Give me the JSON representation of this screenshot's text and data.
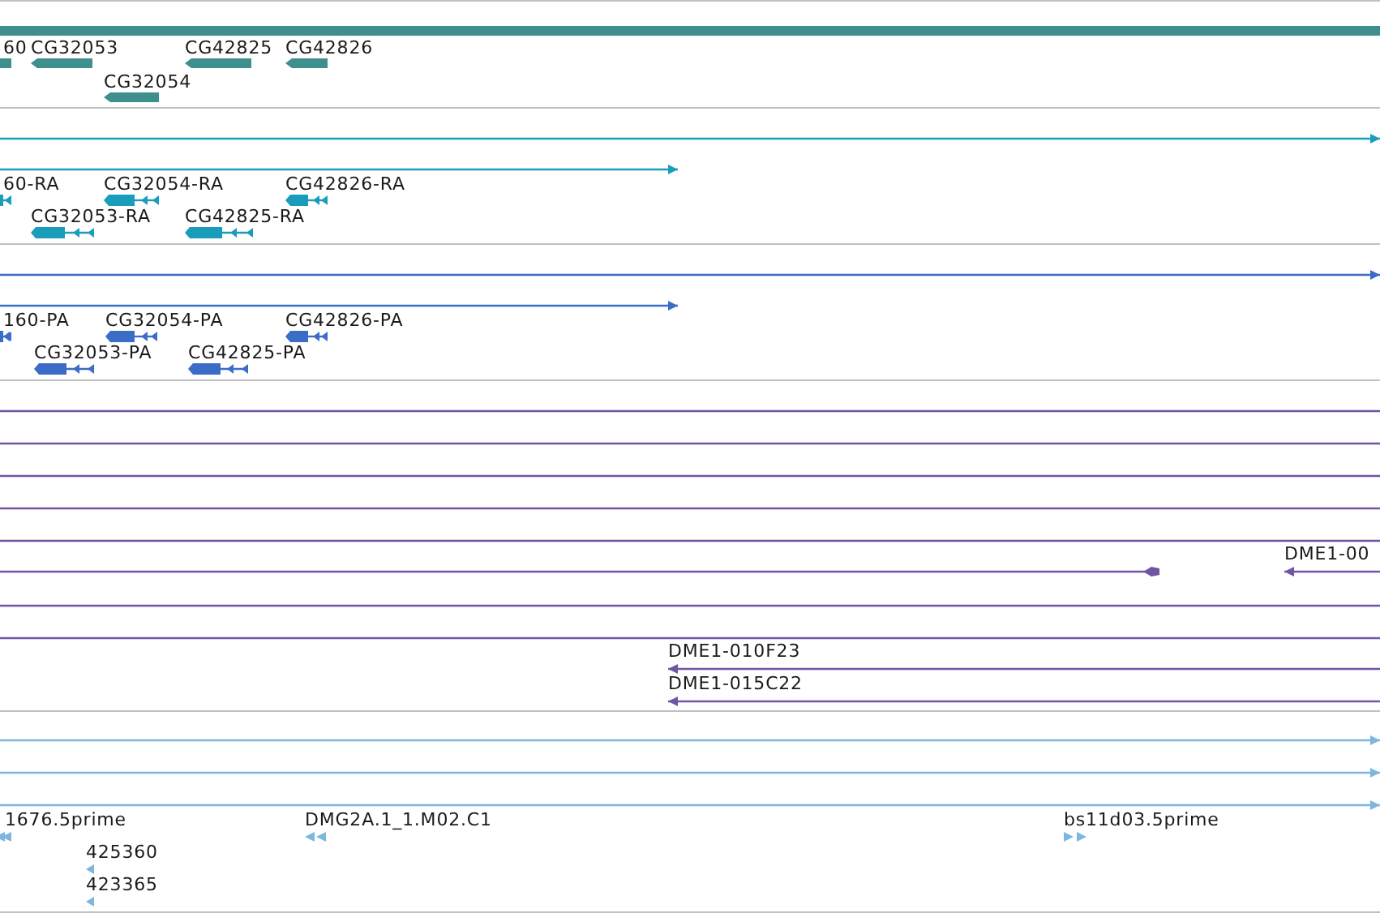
{
  "tracks": [
    {
      "color": "#3f8f8f",
      "features": [
        {
          "kind": "bar"
        },
        {
          "kind": "gene",
          "label": "60",
          "reverse": true
        },
        {
          "kind": "gene",
          "label": "CG32053",
          "reverse": true
        },
        {
          "kind": "gene",
          "label": "CG42825",
          "reverse": true
        },
        {
          "kind": "gene",
          "label": "CG42826",
          "reverse": true
        },
        {
          "kind": "gene",
          "label": "CG32054",
          "reverse": true
        }
      ]
    },
    {
      "color": "#1a9dba",
      "features": [
        {
          "kind": "line",
          "reverse": false
        },
        {
          "kind": "line",
          "reverse": false
        },
        {
          "kind": "transcript",
          "label": "60-RA",
          "reverse": true
        },
        {
          "kind": "transcript",
          "label": "CG32054-RA",
          "reverse": true
        },
        {
          "kind": "transcript",
          "label": "CG42826-RA",
          "reverse": true
        },
        {
          "kind": "transcript",
          "label": "CG32053-RA",
          "reverse": true
        },
        {
          "kind": "transcript",
          "label": "CG42825-RA",
          "reverse": true
        }
      ]
    },
    {
      "color": "#3a6cc8",
      "features": [
        {
          "kind": "line",
          "reverse": false
        },
        {
          "kind": "line",
          "reverse": false
        },
        {
          "kind": "transcript",
          "label": "160-PA",
          "reverse": true
        },
        {
          "kind": "transcript",
          "label": "CG32054-PA",
          "reverse": true
        },
        {
          "kind": "transcript",
          "label": "CG42826-PA",
          "reverse": true
        },
        {
          "kind": "transcript",
          "label": "CG32053-PA",
          "reverse": true
        },
        {
          "kind": "transcript",
          "label": "CG42825-PA",
          "reverse": true
        }
      ]
    },
    {
      "color": "#6f55a3",
      "features": [
        {
          "kind": "span"
        },
        {
          "kind": "span"
        },
        {
          "kind": "span"
        },
        {
          "kind": "span"
        },
        {
          "kind": "span"
        },
        {
          "kind": "line",
          "reverse": true
        },
        {
          "kind": "hit",
          "label": "DME1-00",
          "reverse": true
        },
        {
          "kind": "span"
        },
        {
          "kind": "span"
        },
        {
          "kind": "hit",
          "label": "DME1-010F23",
          "reverse": true
        },
        {
          "kind": "hit",
          "label": "DME1-015C22",
          "reverse": true
        }
      ]
    },
    {
      "color": "#7db6de",
      "features": [
        {
          "kind": "line",
          "reverse": false
        },
        {
          "kind": "line",
          "reverse": false
        },
        {
          "kind": "line",
          "reverse": false
        },
        {
          "kind": "marker",
          "label": "1676.5prime",
          "reverse": true
        },
        {
          "kind": "marker",
          "label": "DMG2A.1_1.M02.C1",
          "reverse": true
        },
        {
          "kind": "marker",
          "label": "bs11d03.5prime",
          "reverse": false
        },
        {
          "kind": "tick",
          "label": "425360",
          "reverse": true
        },
        {
          "kind": "tick",
          "label": "423365",
          "reverse": true
        }
      ]
    }
  ]
}
